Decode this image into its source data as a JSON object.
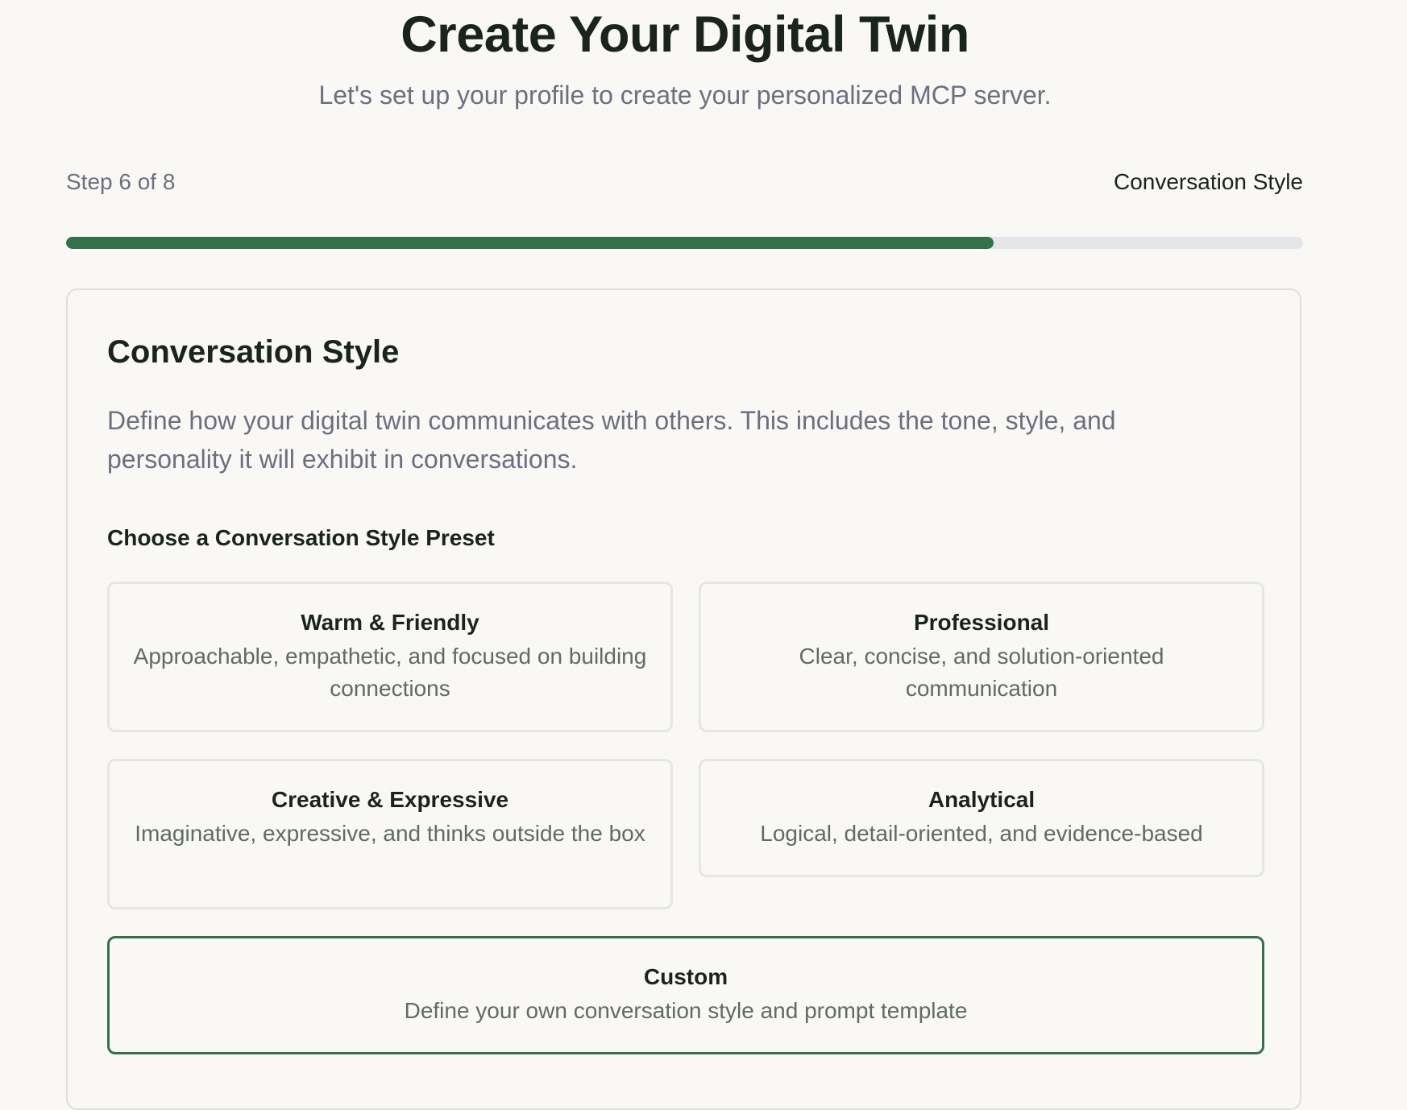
{
  "header": {
    "title": "Create Your Digital Twin",
    "subtitle": "Let's set up your profile to create your personalized MCP server."
  },
  "progress": {
    "step_label": "Step 6 of 8",
    "current_step_name": "Conversation Style",
    "current_step": 6,
    "total_steps": 8,
    "fraction_complete": 0.75,
    "fill_color": "#33714a",
    "track_color": "#e4e6ea"
  },
  "card": {
    "title": "Conversation Style",
    "description": "Define how your digital twin communicates with others. This includes the tone, style, and personality it will exhibit in conversations.",
    "preset_heading": "Choose a Conversation Style Preset",
    "presets": [
      {
        "name": "Warm & Friendly",
        "description": "Approachable, empathetic, and focused on building connections",
        "selected": false
      },
      {
        "name": "Professional",
        "description": "Clear, concise, and solution-oriented communication",
        "selected": false
      },
      {
        "name": "Creative & Expressive",
        "description": "Imaginative, expressive, and thinks outside the box",
        "selected": false
      },
      {
        "name": "Analytical",
        "description": "Logical, detail-oriented, and evidence-based",
        "selected": false
      },
      {
        "name": "Custom",
        "description": "Define your own conversation style and prompt template",
        "selected": true
      }
    ]
  },
  "colors": {
    "accent": "#33714a",
    "background": "#f9f8f5",
    "heading": "#1a241f",
    "muted_text": "#6b7080",
    "preset_desc_text": "#5e6c63"
  }
}
